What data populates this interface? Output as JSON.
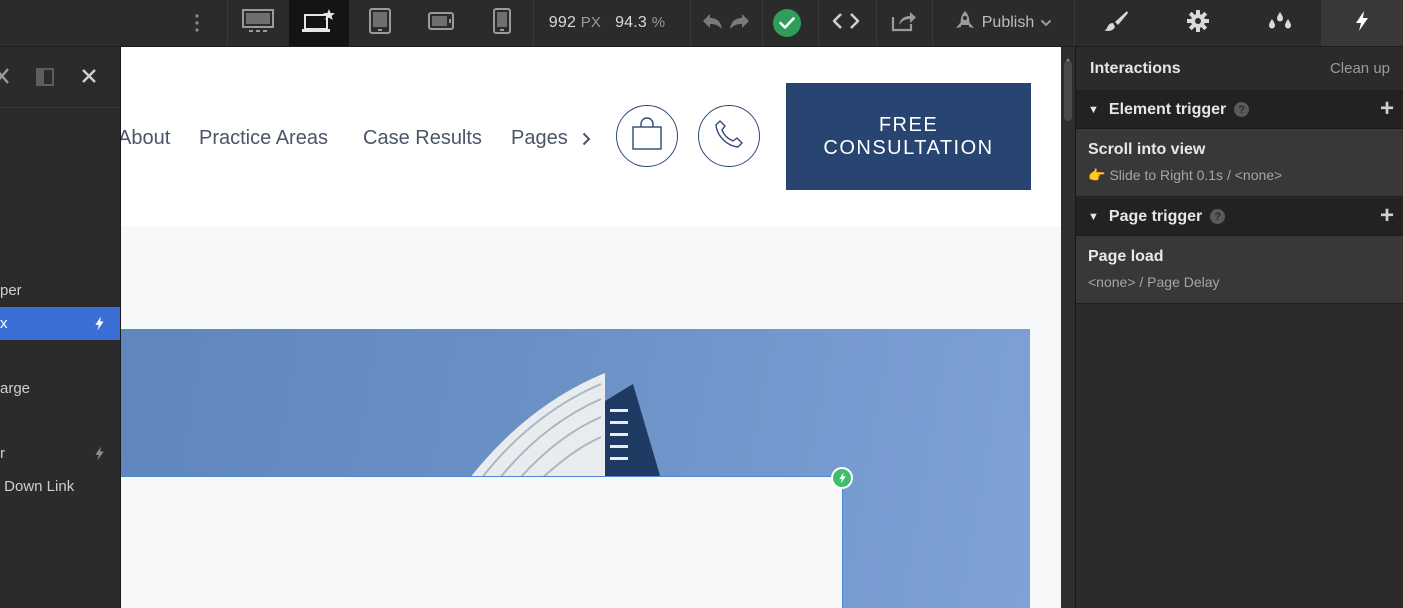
{
  "toolbar": {
    "width_value": "992",
    "width_unit": "PX",
    "zoom_value": "94.3",
    "zoom_unit": "%",
    "publish_label": "Publish",
    "icons": [
      "more-vertical-icon",
      "desktop-large-icon",
      "desktop-base-icon",
      "tablet-icon",
      "mobile-landscape-icon",
      "mobile-portrait-icon",
      "undo-icon",
      "redo-icon",
      "check-icon",
      "code-icon",
      "export-icon",
      "publish-icon",
      "chevron-down-icon"
    ],
    "panel_tabs": [
      "style-brush-icon",
      "settings-gear-icon",
      "style-manager-drops-icon",
      "interactions-bolt-icon"
    ],
    "active_breakpoint": "desktop-base",
    "active_panel": "interactions",
    "check_color": "#2f9e5b"
  },
  "navigator": {
    "rows": [
      {
        "label": "per",
        "selected": false,
        "has_interaction": false
      },
      {
        "label": "x",
        "selected": true,
        "has_interaction": true
      },
      {
        "label": "arge",
        "selected": false,
        "has_interaction": false
      },
      {
        "label": "r",
        "selected": false,
        "has_interaction": true
      },
      {
        "label": " Down Link",
        "selected": false,
        "has_interaction": false
      }
    ],
    "selected_color": "#3b6fd6"
  },
  "site": {
    "nav": [
      "About",
      "Practice Areas",
      "Case Results",
      "Pages"
    ],
    "cta_line1": "FREE",
    "cta_line2": "CONSULTATION",
    "brand_color": "#284571"
  },
  "interactions": {
    "title": "Interactions",
    "clean_up": "Clean up",
    "element_trigger": {
      "label": "Element trigger",
      "help": "?",
      "items": [
        {
          "name": "Scroll into view",
          "desc": "Slide to Right 0.1s / <none>"
        }
      ]
    },
    "page_trigger": {
      "label": "Page trigger",
      "help": "?",
      "items": [
        {
          "name": "Page load",
          "desc": "<none> / Page Delay"
        }
      ]
    }
  }
}
